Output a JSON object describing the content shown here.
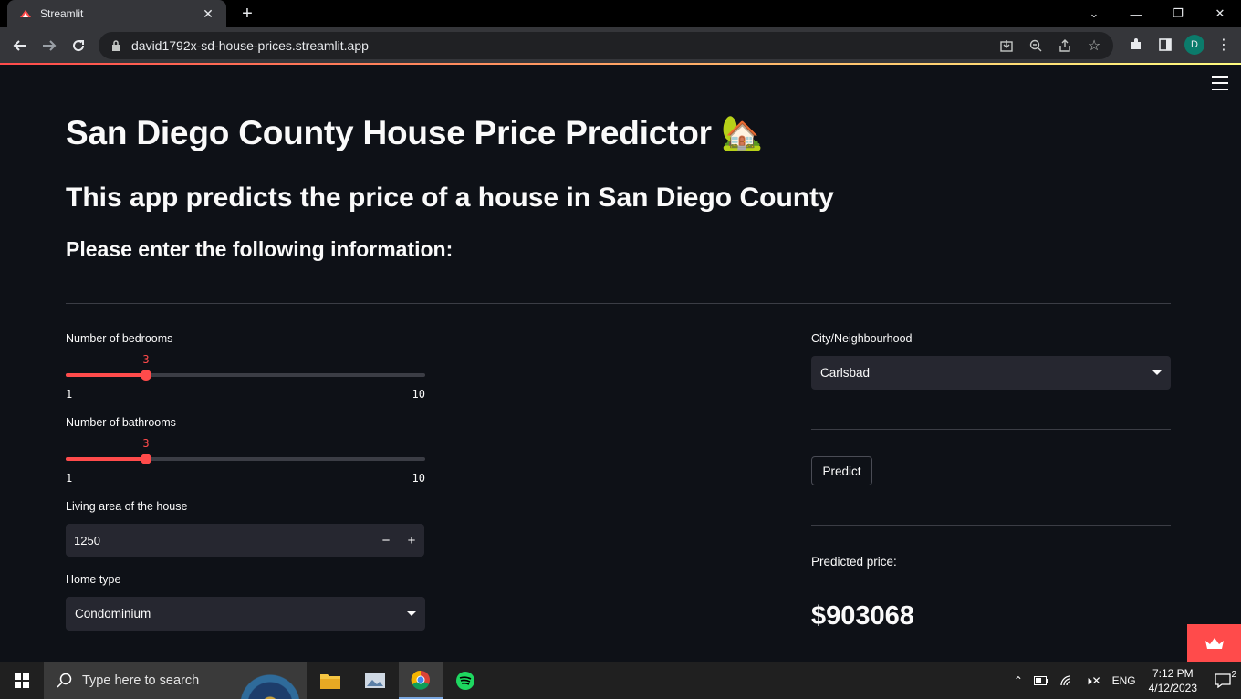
{
  "browser": {
    "tab_title": "Streamlit",
    "url": "david1792x-sd-house-prices.streamlit.app",
    "profile_initial": "D"
  },
  "app": {
    "title": "San Diego County House Price Predictor 🏡",
    "subtitle": "This app predicts the price of a house in San Diego County",
    "prompt": "Please enter the following information:",
    "bedrooms": {
      "label": "Number of bedrooms",
      "value": "3",
      "min": "1",
      "max": "10"
    },
    "bathrooms": {
      "label": "Number of bathrooms",
      "value": "3",
      "min": "1",
      "max": "10"
    },
    "living_area": {
      "label": "Living area of the house",
      "value": "1250"
    },
    "home_type": {
      "label": "Home type",
      "value": "Condominium"
    },
    "city": {
      "label": "City/Neighbourhood",
      "value": "Carlsbad"
    },
    "predict_label": "Predict",
    "predicted_label": "Predicted price:",
    "predicted_value": "$903068",
    "accent_color": "#ff4b4b"
  },
  "taskbar": {
    "search_placeholder": "Type here to search",
    "language": "ENG",
    "time": "7:12 PM",
    "date": "4/12/2023",
    "notification_count": "2"
  }
}
